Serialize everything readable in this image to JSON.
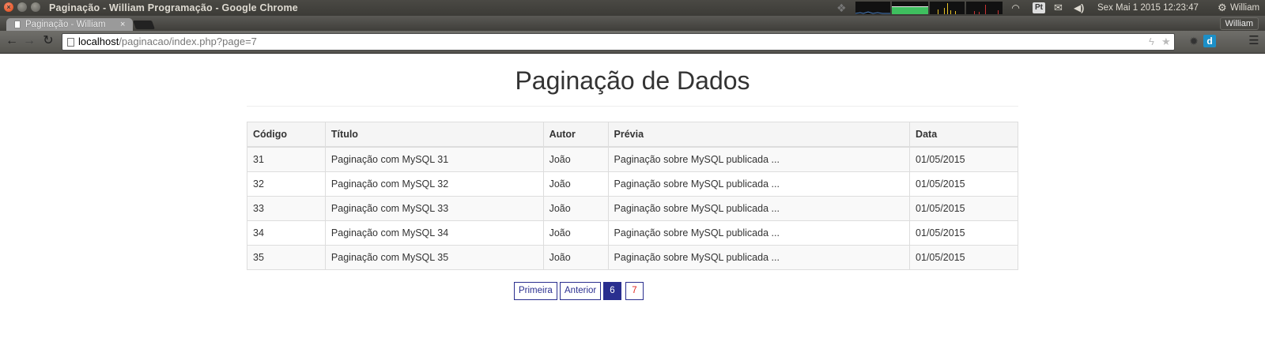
{
  "os_panel": {
    "window_title": "Paginação - William Programação - Google Chrome",
    "datetime": "Sex Mai  1 2015   12:23:47",
    "user": "William",
    "tray_icons": [
      "dropbox-icon",
      "system-monitor-graphs",
      "wifi-icon",
      "pt-icon",
      "mail-icon",
      "volume-icon",
      "power-gear-icon"
    ]
  },
  "browser": {
    "tab_title": "Paginação - William",
    "profile_name": "William",
    "url_host": "localhost",
    "url_path": "/paginacao/index.php?page=7"
  },
  "page": {
    "title": "Paginação de Dados",
    "table": {
      "headers": [
        "Código",
        "Título",
        "Autor",
        "Prévia",
        "Data"
      ],
      "rows": [
        [
          "31",
          "Paginação com MySQL 31",
          "João",
          "Paginação sobre MySQL publicada ...",
          "01/05/2015"
        ],
        [
          "32",
          "Paginação com MySQL 32",
          "João",
          "Paginação sobre MySQL publicada ...",
          "01/05/2015"
        ],
        [
          "33",
          "Paginação com MySQL 33",
          "João",
          "Paginação sobre MySQL publicada ...",
          "01/05/2015"
        ],
        [
          "34",
          "Paginação com MySQL 34",
          "João",
          "Paginação sobre MySQL publicada ...",
          "01/05/2015"
        ],
        [
          "35",
          "Paginação com MySQL 35",
          "João",
          "Paginação sobre MySQL publicada ...",
          "01/05/2015"
        ]
      ]
    },
    "pagination": {
      "first_label": "Primeira",
      "prev_label": "Anterior",
      "current_page": "6",
      "next_page": "7"
    }
  },
  "colors": {
    "pagination_accent": "#2a2f8f",
    "next_page_text": "#e0231e"
  }
}
